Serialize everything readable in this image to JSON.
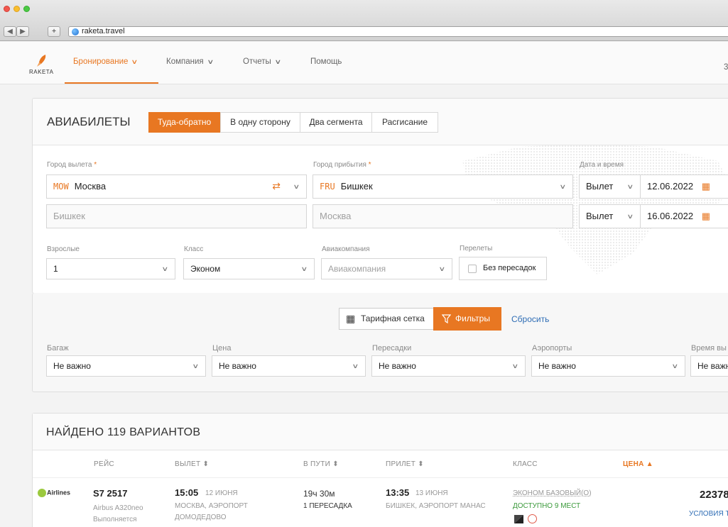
{
  "browser": {
    "url": "raketa.travel",
    "back": "◀",
    "forward": "▶",
    "plus": "+"
  },
  "header": {
    "logo_text": "RAKETA",
    "menu": [
      "Бронирование",
      "Компания",
      "Отчеты",
      "Помощь"
    ],
    "right_partial": "3"
  },
  "search": {
    "title": "АВИАБИЛЕТЫ",
    "trip_types": [
      "Туда-обратно",
      "В одну сторону",
      "Два сегмента",
      "Расгисание"
    ],
    "departure_label": "Город вылета",
    "arrival_label": "Город прибытия",
    "required": "*",
    "datetime_label": "Дата и время",
    "departure": {
      "code": "MOW",
      "city": "Москва"
    },
    "arrival": {
      "code": "FRU",
      "city": "Бишкек"
    },
    "return_from": "Бишкек",
    "return_to": "Москва",
    "date1": {
      "mode": "Вылет",
      "date": "12.06.2022"
    },
    "date2": {
      "mode": "Вылет",
      "date": "16.06.2022"
    },
    "adults_label": "Взрослые",
    "adults_value": "1",
    "class_label": "Класс",
    "class_value": "Эконом",
    "airline_label": "Авиакомпания",
    "airline_placeholder": "Авиакомпания",
    "transfers_label": "Перелеты",
    "nonstop_label": "Без пересадок"
  },
  "filters": {
    "tariff_grid": "Тарифная сетка",
    "filters_button": "Фильтры",
    "reset": "Сбросить",
    "items": [
      {
        "label": "Багаж",
        "value": "Не важно"
      },
      {
        "label": "Цена",
        "value": "Не важно"
      },
      {
        "label": "Пересадки",
        "value": "Не важно"
      },
      {
        "label": "Аэропорты",
        "value": "Не важно"
      },
      {
        "label": "Время вы",
        "value": "Не важн"
      }
    ]
  },
  "results": {
    "title": "НАЙДЕНО 119 ВАРИАНТОВ",
    "columns": [
      "РЕЙС",
      "ВЫЛЕТ",
      "В ПУТИ",
      "ПРИЛЕТ",
      "КЛАСС",
      "ЦЕНА"
    ],
    "sort_mark": "⬍",
    "price_sort_mark": "▲",
    "row": {
      "airline_logo_text": "Airlines",
      "flight": "S7 2517",
      "aircraft": "Airbus A320neo",
      "operated": "Выполняется",
      "dep_time": "15:05",
      "dep_date": "12 ИЮНЯ",
      "dep_airport_1": "МОСКВА, АЭРОПОРТ",
      "dep_airport_2": "ДОМОДЕДОВО",
      "duration": "19ч 30м",
      "transfers": "1 ПЕРЕСАДКА",
      "arr_time": "13:35",
      "arr_date": "13 ИЮНЯ",
      "arr_airport": "БИШКЕК, АЭРОПОРТ МАНАС",
      "fare_class": "ЭКОНОМ БАЗОВЫЙ(O)",
      "availability": "ДОСТУПНО 9 МЕСТ",
      "price": "22378",
      "conditions": "УСЛОВИЯ Т"
    }
  },
  "colors": {
    "accent": "#e87722",
    "link": "#2f6db5",
    "green": "#3c9a3c"
  }
}
